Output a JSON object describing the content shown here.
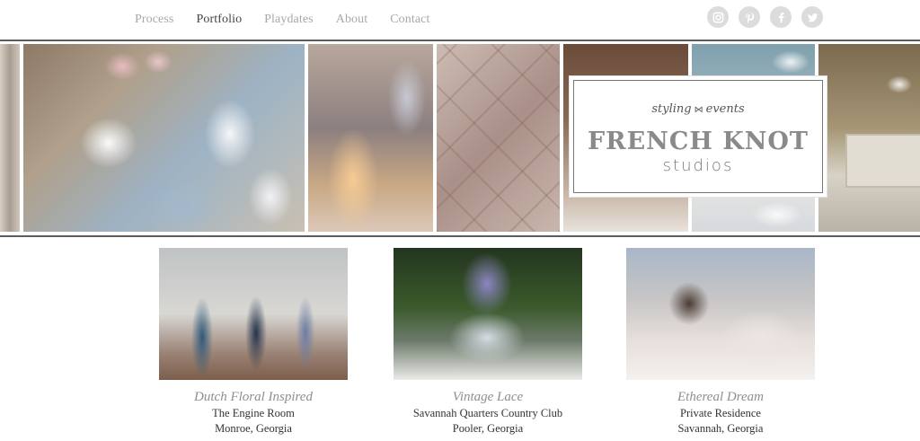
{
  "nav": {
    "items": [
      {
        "label": "Process",
        "active": false
      },
      {
        "label": "Portfolio",
        "active": true
      },
      {
        "label": "Playdates",
        "active": false
      },
      {
        "label": "About",
        "active": false
      },
      {
        "label": "Contact",
        "active": false
      }
    ]
  },
  "social": [
    {
      "name": "instagram-icon"
    },
    {
      "name": "pinterest-icon"
    },
    {
      "name": "facebook-icon"
    },
    {
      "name": "twitter-icon"
    }
  ],
  "logo": {
    "script_left": "styling",
    "script_right": "events",
    "title": "FRENCH KNOT",
    "subtitle": "studios"
  },
  "portfolio": [
    {
      "title": "Dutch Floral Inspired",
      "venue": "The Engine Room",
      "location": "Monroe, Georgia"
    },
    {
      "title": "Vintage Lace",
      "venue": "Savannah Quarters Country Club",
      "location": "Pooler, Georgia"
    },
    {
      "title": "Ethereal Dream",
      "venue": "Private Residence",
      "location": "Savannah, Georgia"
    }
  ],
  "colors": {
    "nav_inactive": "#a8a8a8",
    "nav_active": "#444444",
    "social_bg": "#dcdcdc",
    "caption_title": "#8e8e8e",
    "rule": "#5c5c5c"
  }
}
